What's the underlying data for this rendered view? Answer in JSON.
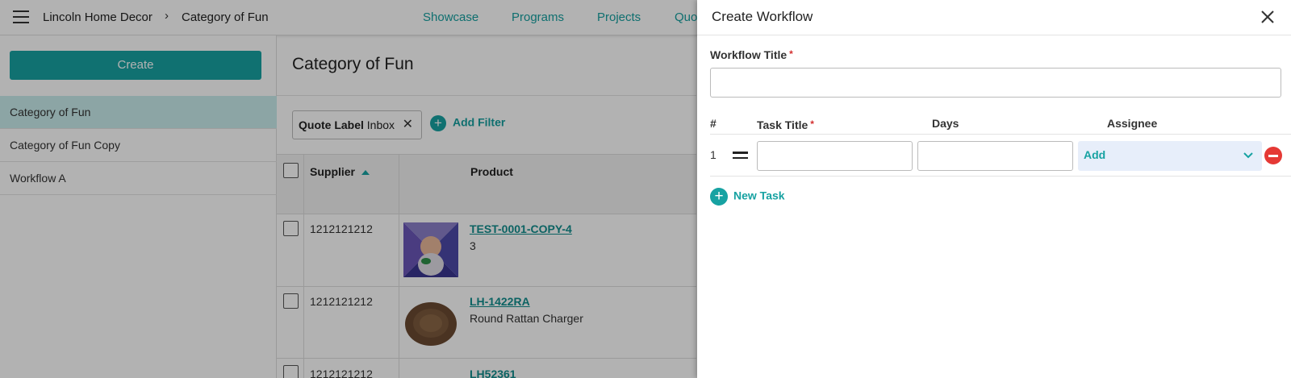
{
  "header": {
    "breadcrumb": [
      "Lincoln Home Decor",
      "Category of Fun"
    ],
    "nav": [
      "Showcase",
      "Programs",
      "Projects",
      "Quo"
    ]
  },
  "sidebar": {
    "create_label": "Create",
    "items": [
      {
        "label": "Category of Fun",
        "active": true
      },
      {
        "label": "Category of Fun Copy",
        "active": false
      },
      {
        "label": "Workflow A",
        "active": false
      }
    ]
  },
  "main": {
    "title": "Category of Fun",
    "filter": {
      "name": "Quote Label",
      "value": "Inbox"
    },
    "add_filter_label": "Add Filter",
    "columns": [
      "Supplier",
      "Product"
    ],
    "rows": [
      {
        "supplier": "1212121212",
        "sku": "TEST-0001-COPY-4",
        "desc": "3"
      },
      {
        "supplier": "1212121212",
        "sku": "LH-1422RA",
        "desc": "Round Rattan Charger"
      },
      {
        "supplier": "1212121212",
        "sku": "LH52361",
        "desc": ""
      }
    ]
  },
  "drawer": {
    "title": "Create Workflow",
    "workflow_title_label": "Workflow Title",
    "workflow_title_value": "",
    "columns": {
      "num": "#",
      "task_title": "Task Title",
      "days": "Days",
      "assignee": "Assignee"
    },
    "tasks": [
      {
        "num": "1",
        "title": "",
        "days": "",
        "assignee": "Add"
      }
    ],
    "new_task_label": "New Task"
  },
  "colors": {
    "accent": "#17a2a2",
    "danger": "#e53935",
    "active_row": "#c9ecec"
  }
}
